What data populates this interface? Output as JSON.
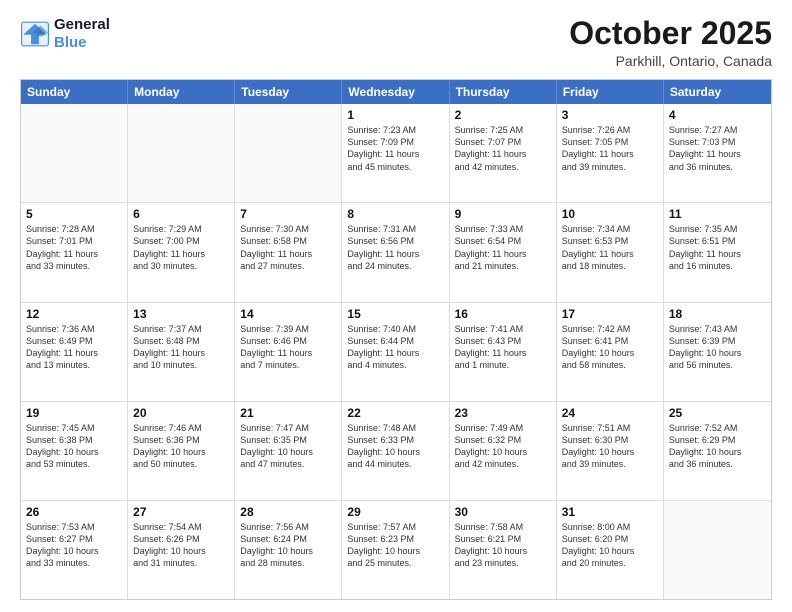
{
  "header": {
    "logo_line1": "General",
    "logo_line2": "Blue",
    "month": "October 2025",
    "location": "Parkhill, Ontario, Canada"
  },
  "weekdays": [
    "Sunday",
    "Monday",
    "Tuesday",
    "Wednesday",
    "Thursday",
    "Friday",
    "Saturday"
  ],
  "rows": [
    [
      {
        "day": "",
        "text": "",
        "empty": true
      },
      {
        "day": "",
        "text": "",
        "empty": true
      },
      {
        "day": "",
        "text": "",
        "empty": true
      },
      {
        "day": "1",
        "text": "Sunrise: 7:23 AM\nSunset: 7:09 PM\nDaylight: 11 hours\nand 45 minutes.",
        "empty": false
      },
      {
        "day": "2",
        "text": "Sunrise: 7:25 AM\nSunset: 7:07 PM\nDaylight: 11 hours\nand 42 minutes.",
        "empty": false
      },
      {
        "day": "3",
        "text": "Sunrise: 7:26 AM\nSunset: 7:05 PM\nDaylight: 11 hours\nand 39 minutes.",
        "empty": false
      },
      {
        "day": "4",
        "text": "Sunrise: 7:27 AM\nSunset: 7:03 PM\nDaylight: 11 hours\nand 36 minutes.",
        "empty": false
      }
    ],
    [
      {
        "day": "5",
        "text": "Sunrise: 7:28 AM\nSunset: 7:01 PM\nDaylight: 11 hours\nand 33 minutes.",
        "empty": false
      },
      {
        "day": "6",
        "text": "Sunrise: 7:29 AM\nSunset: 7:00 PM\nDaylight: 11 hours\nand 30 minutes.",
        "empty": false
      },
      {
        "day": "7",
        "text": "Sunrise: 7:30 AM\nSunset: 6:58 PM\nDaylight: 11 hours\nand 27 minutes.",
        "empty": false
      },
      {
        "day": "8",
        "text": "Sunrise: 7:31 AM\nSunset: 6:56 PM\nDaylight: 11 hours\nand 24 minutes.",
        "empty": false
      },
      {
        "day": "9",
        "text": "Sunrise: 7:33 AM\nSunset: 6:54 PM\nDaylight: 11 hours\nand 21 minutes.",
        "empty": false
      },
      {
        "day": "10",
        "text": "Sunrise: 7:34 AM\nSunset: 6:53 PM\nDaylight: 11 hours\nand 18 minutes.",
        "empty": false
      },
      {
        "day": "11",
        "text": "Sunrise: 7:35 AM\nSunset: 6:51 PM\nDaylight: 11 hours\nand 16 minutes.",
        "empty": false
      }
    ],
    [
      {
        "day": "12",
        "text": "Sunrise: 7:36 AM\nSunset: 6:49 PM\nDaylight: 11 hours\nand 13 minutes.",
        "empty": false
      },
      {
        "day": "13",
        "text": "Sunrise: 7:37 AM\nSunset: 6:48 PM\nDaylight: 11 hours\nand 10 minutes.",
        "empty": false
      },
      {
        "day": "14",
        "text": "Sunrise: 7:39 AM\nSunset: 6:46 PM\nDaylight: 11 hours\nand 7 minutes.",
        "empty": false
      },
      {
        "day": "15",
        "text": "Sunrise: 7:40 AM\nSunset: 6:44 PM\nDaylight: 11 hours\nand 4 minutes.",
        "empty": false
      },
      {
        "day": "16",
        "text": "Sunrise: 7:41 AM\nSunset: 6:43 PM\nDaylight: 11 hours\nand 1 minute.",
        "empty": false
      },
      {
        "day": "17",
        "text": "Sunrise: 7:42 AM\nSunset: 6:41 PM\nDaylight: 10 hours\nand 58 minutes.",
        "empty": false
      },
      {
        "day": "18",
        "text": "Sunrise: 7:43 AM\nSunset: 6:39 PM\nDaylight: 10 hours\nand 56 minutes.",
        "empty": false
      }
    ],
    [
      {
        "day": "19",
        "text": "Sunrise: 7:45 AM\nSunset: 6:38 PM\nDaylight: 10 hours\nand 53 minutes.",
        "empty": false
      },
      {
        "day": "20",
        "text": "Sunrise: 7:46 AM\nSunset: 6:36 PM\nDaylight: 10 hours\nand 50 minutes.",
        "empty": false
      },
      {
        "day": "21",
        "text": "Sunrise: 7:47 AM\nSunset: 6:35 PM\nDaylight: 10 hours\nand 47 minutes.",
        "empty": false
      },
      {
        "day": "22",
        "text": "Sunrise: 7:48 AM\nSunset: 6:33 PM\nDaylight: 10 hours\nand 44 minutes.",
        "empty": false
      },
      {
        "day": "23",
        "text": "Sunrise: 7:49 AM\nSunset: 6:32 PM\nDaylight: 10 hours\nand 42 minutes.",
        "empty": false
      },
      {
        "day": "24",
        "text": "Sunrise: 7:51 AM\nSunset: 6:30 PM\nDaylight: 10 hours\nand 39 minutes.",
        "empty": false
      },
      {
        "day": "25",
        "text": "Sunrise: 7:52 AM\nSunset: 6:29 PM\nDaylight: 10 hours\nand 36 minutes.",
        "empty": false
      }
    ],
    [
      {
        "day": "26",
        "text": "Sunrise: 7:53 AM\nSunset: 6:27 PM\nDaylight: 10 hours\nand 33 minutes.",
        "empty": false
      },
      {
        "day": "27",
        "text": "Sunrise: 7:54 AM\nSunset: 6:26 PM\nDaylight: 10 hours\nand 31 minutes.",
        "empty": false
      },
      {
        "day": "28",
        "text": "Sunrise: 7:56 AM\nSunset: 6:24 PM\nDaylight: 10 hours\nand 28 minutes.",
        "empty": false
      },
      {
        "day": "29",
        "text": "Sunrise: 7:57 AM\nSunset: 6:23 PM\nDaylight: 10 hours\nand 25 minutes.",
        "empty": false
      },
      {
        "day": "30",
        "text": "Sunrise: 7:58 AM\nSunset: 6:21 PM\nDaylight: 10 hours\nand 23 minutes.",
        "empty": false
      },
      {
        "day": "31",
        "text": "Sunrise: 8:00 AM\nSunset: 6:20 PM\nDaylight: 10 hours\nand 20 minutes.",
        "empty": false
      },
      {
        "day": "",
        "text": "",
        "empty": true
      }
    ]
  ]
}
